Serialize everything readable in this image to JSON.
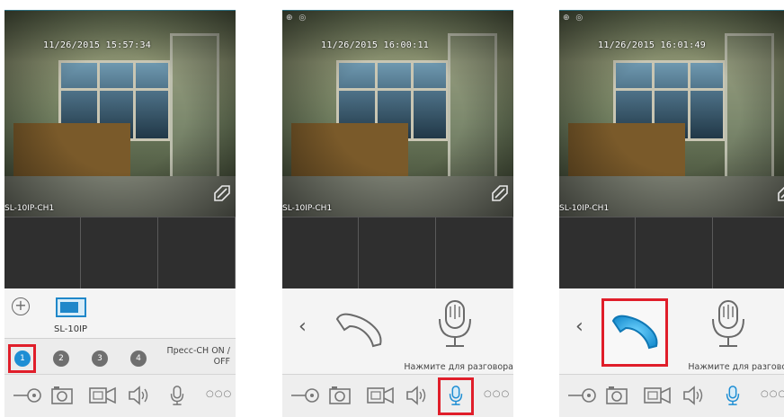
{
  "screens": [
    {
      "timestamp": "11/26/2015 15:57:34",
      "camera_label": "SL-10IP-CH1",
      "device_name": "SL-10IP",
      "channels": [
        "1",
        "2",
        "3",
        "4"
      ],
      "active_channel": "1",
      "press_label": "Пресс-CH ON / OFF"
    },
    {
      "timestamp": "11/26/2015 16:00:11",
      "camera_label": "SL-10IP-CH1",
      "talk_label": "Нажмите для разговора",
      "status_icons": "⊕ ◎"
    },
    {
      "timestamp": "11/26/2015 16:01:49",
      "camera_label": "SL-10IP-CH1",
      "talk_label": "Нажмите для разговора",
      "status_icons": "⊕ ◎"
    }
  ],
  "toolbar": {
    "icons": [
      "key-icon",
      "camera-icon",
      "video-icon",
      "speaker-icon",
      "microphone-icon",
      "more-icon"
    ],
    "more_label": "○○○"
  },
  "colors": {
    "accent": "#1e8ed4",
    "highlight": "#e01e2a",
    "handset_active": "#2fb4ec"
  }
}
